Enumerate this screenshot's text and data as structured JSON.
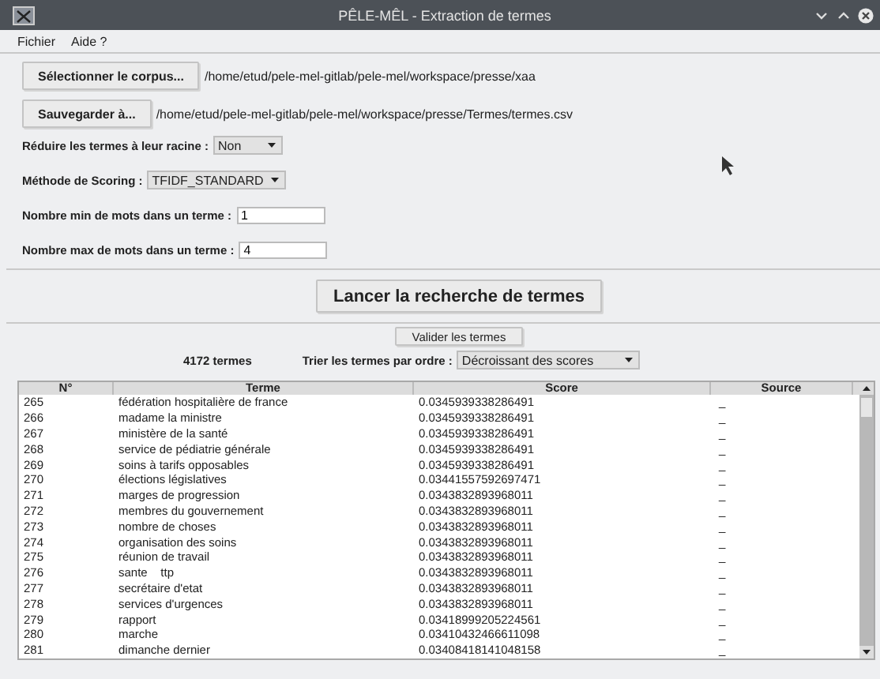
{
  "window": {
    "title": "PÊLE-MÊL - Extraction de termes"
  },
  "menu": [
    "Fichier",
    "Aide ?"
  ],
  "corpus": {
    "button": "Sélectionner le corpus...",
    "path": "/home/etud/pele-mel-gitlab/pele-mel/workspace/presse/xaa"
  },
  "save": {
    "button": "Sauvegarder à...",
    "path": "/home/etud/pele-mel-gitlab/pele-mel/workspace/presse/Termes/termes.csv"
  },
  "settings": [
    {
      "kind": "select",
      "label": "Réduire les termes à leur racine :",
      "value": "Non"
    },
    {
      "kind": "select",
      "label": "Méthode de Scoring :",
      "value": "TFIDF_STANDARD"
    },
    {
      "kind": "input",
      "label": "Nombre min de mots dans un terme :",
      "value": "1"
    },
    {
      "kind": "input",
      "label": "Nombre max de mots dans un terme :",
      "value": "4"
    }
  ],
  "search_button": "Lancer la recherche de termes",
  "validate_button": "Valider les termes",
  "count": "4172 termes",
  "sort": {
    "label": "Trier les termes par ordre :",
    "value": "Décroissant des scores"
  },
  "table": {
    "columns": [
      "N°",
      "Terme",
      "Score",
      "Source"
    ],
    "rows": [
      [
        "265",
        "fédération hospitalière de france",
        "0.0345939338286491",
        "_"
      ],
      [
        "266",
        "madame la ministre",
        "0.0345939338286491",
        "_"
      ],
      [
        "267",
        "ministère de la santé",
        "0.0345939338286491",
        "_"
      ],
      [
        "268",
        "service de pédiatrie générale",
        "0.0345939338286491",
        "_"
      ],
      [
        "269",
        "soins à tarifs opposables",
        "0.0345939338286491",
        "_"
      ],
      [
        "270",
        "élections législatives",
        "0.03441557592697471",
        "_"
      ],
      [
        "271",
        "marges de progression",
        "0.0343832893968011",
        "_"
      ],
      [
        "272",
        "membres du gouvernement",
        "0.0343832893968011",
        "_"
      ],
      [
        "273",
        "nombre de choses",
        "0.0343832893968011",
        "_"
      ],
      [
        "274",
        "organisation des soins",
        "0.0343832893968011",
        "_"
      ],
      [
        "275",
        "réunion de travail",
        "0.0343832893968011",
        "_"
      ],
      [
        "276",
        "sante    ttp",
        "0.0343832893968011",
        "_"
      ],
      [
        "277",
        "secrétaire d'etat",
        "0.0343832893968011",
        "_"
      ],
      [
        "278",
        "services d'urgences",
        "0.0343832893968011",
        "_"
      ],
      [
        "279",
        "rapport",
        "0.03418999205224561",
        "_"
      ],
      [
        "280",
        "marche",
        "0.03410432466611098",
        "_"
      ],
      [
        "281",
        "dimanche dernier",
        "0.03408418141048158",
        "_"
      ]
    ]
  }
}
